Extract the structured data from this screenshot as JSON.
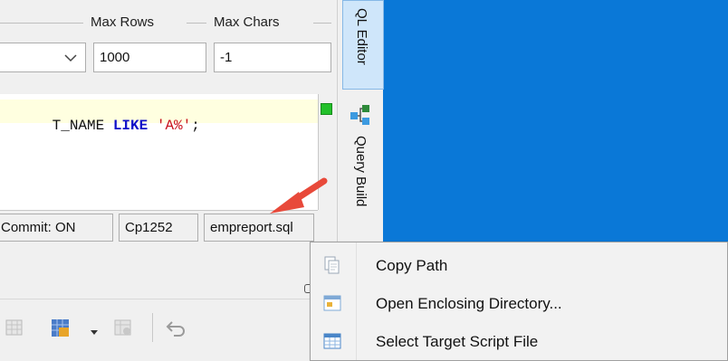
{
  "header": {
    "max_rows_label": "Max Rows",
    "max_chars_label": "Max Chars"
  },
  "inputs": {
    "connection_value": "",
    "max_rows_value": "1000",
    "max_chars_value": "-1"
  },
  "editor": {
    "tokens": [
      {
        "text": "T_NAME ",
        "kind": "ident"
      },
      {
        "text": "LIKE ",
        "kind": "keyword"
      },
      {
        "text": "'A%'",
        "kind": "string"
      },
      {
        "text": ";",
        "kind": "ident"
      }
    ]
  },
  "status_bar": {
    "autocommit": "Commit: ON",
    "encoding": "Cp1252",
    "file": "empreport.sql"
  },
  "side_tabs": {
    "sql_editor": "QL Editor",
    "query_builder": "Query Build"
  },
  "context_menu": {
    "items": [
      {
        "label": "Copy Path",
        "icon": "copy-path-icon"
      },
      {
        "label": "Open Enclosing Directory...",
        "icon": "open-directory-icon"
      },
      {
        "label": "Select Target Script File",
        "icon": "select-script-icon"
      }
    ]
  },
  "colors": {
    "desktop": "#0A78D7",
    "keyword": "#1010C8",
    "string": "#C8121E",
    "annotation_arrow": "#E8493A",
    "active_tab": "#CFE6FA"
  }
}
